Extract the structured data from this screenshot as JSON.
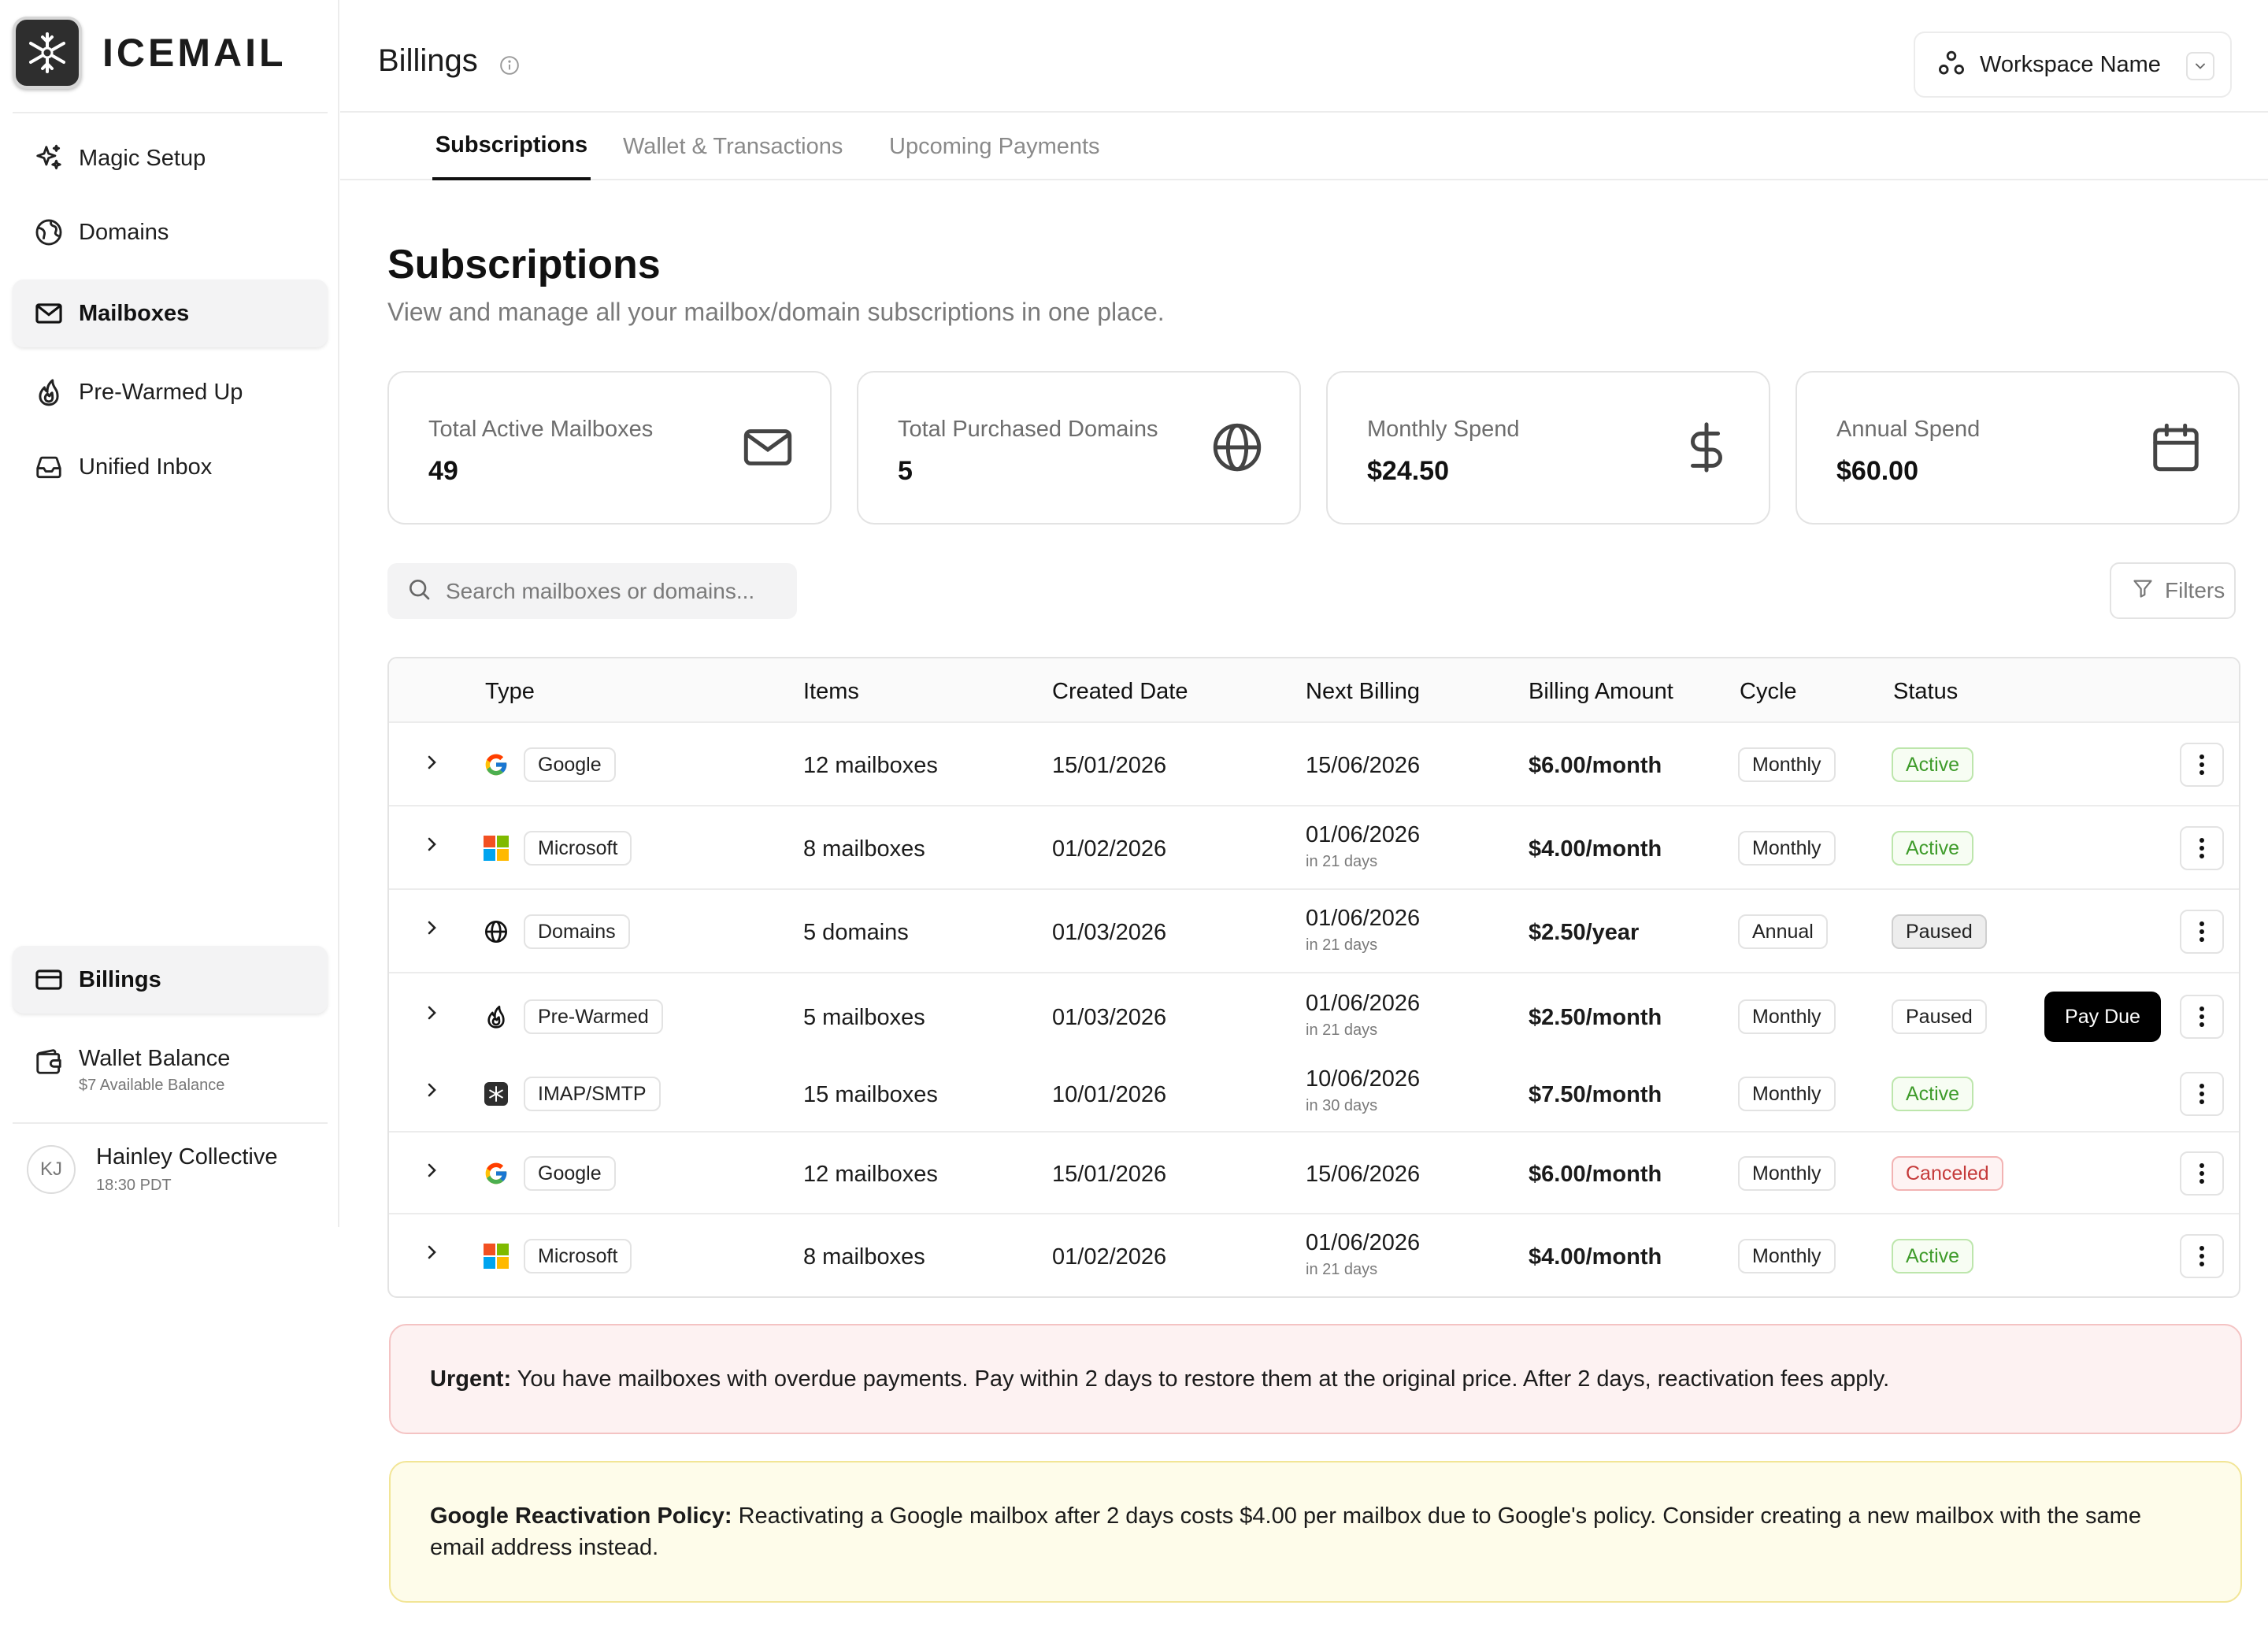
{
  "app": {
    "name": "ICEMAIL"
  },
  "sidebar": {
    "items": [
      {
        "label": "Magic Setup",
        "icon": "sparkles-icon"
      },
      {
        "label": "Domains",
        "icon": "globe-icon"
      },
      {
        "label": "Mailboxes",
        "icon": "mail-icon",
        "active": true
      },
      {
        "label": "Pre-Warmed Up",
        "icon": "flame-icon"
      },
      {
        "label": "Unified Inbox",
        "icon": "inbox-icon"
      }
    ],
    "billings": {
      "label": "Billings",
      "icon": "credit-card-icon",
      "active": true
    },
    "wallet": {
      "label": "Wallet Balance",
      "sub": "$7 Available Balance",
      "icon": "wallet-icon"
    },
    "user": {
      "initials": "KJ",
      "name": "Hainley Collective",
      "time": "18:30 PDT"
    }
  },
  "header": {
    "title": "Billings",
    "workspace": "Workspace Name"
  },
  "tabs": [
    {
      "label": "Subscriptions",
      "active": true
    },
    {
      "label": "Wallet & Transactions",
      "active": false
    },
    {
      "label": "Upcoming Payments",
      "active": false
    }
  ],
  "main": {
    "title": "Subscriptions",
    "subtitle": "View and manage all your mailbox/domain subscriptions in one place.",
    "cards": [
      {
        "label": "Total Active Mailboxes",
        "value": "49",
        "icon": "mail-icon"
      },
      {
        "label": "Total Purchased Domains",
        "value": "5",
        "icon": "globe-icon"
      },
      {
        "label": "Monthly Spend",
        "value": "$24.50",
        "icon": "dollar-icon"
      },
      {
        "label": "Annual Spend",
        "value": "$60.00",
        "icon": "calendar-icon"
      }
    ],
    "search_placeholder": "Search mailboxes or domains...",
    "filters_label": "Filters"
  },
  "table": {
    "columns": [
      "Type",
      "Items",
      "Created Date",
      "Next Billing",
      "Billing Amount",
      "Cycle",
      "Status"
    ],
    "pay_due_label": "Pay Due",
    "rows": [
      {
        "type": "Google",
        "icon": "google-icon",
        "items": "12 mailboxes",
        "created": "15/01/2026",
        "next": "15/06/2026",
        "next_sub": "",
        "amount": "$6.00/month",
        "cycle": "Monthly",
        "status": "Active",
        "status_kind": "active"
      },
      {
        "type": "Microsoft",
        "icon": "microsoft-icon",
        "items": "8 mailboxes",
        "created": "01/02/2026",
        "next": "01/06/2026",
        "next_sub": "in 21 days",
        "amount": "$4.00/month",
        "cycle": "Monthly",
        "status": "Active",
        "status_kind": "active"
      },
      {
        "type": "Domains",
        "icon": "globe-icon",
        "items": "5 domains",
        "created": "01/03/2026",
        "next": "01/06/2026",
        "next_sub": "in 21 days",
        "amount": "$2.50/year",
        "cycle": "Annual",
        "status": "Paused",
        "status_kind": "paused"
      },
      {
        "type": "Pre-Warmed",
        "icon": "flame-icon",
        "items": "5 mailboxes",
        "created": "01/03/2026",
        "next": "01/06/2026",
        "next_sub": "in 21 days",
        "amount": "$2.50/month",
        "cycle": "Monthly",
        "status": "Paused",
        "status_kind": "paused2",
        "pay_due": true
      },
      {
        "type": "IMAP/SMTP",
        "icon": "imap-icon",
        "items": "15 mailboxes",
        "created": "10/01/2026",
        "next": "10/06/2026",
        "next_sub": "in 30 days",
        "amount": "$7.50/month",
        "cycle": "Monthly",
        "status": "Active",
        "status_kind": "active"
      },
      {
        "type": "Google",
        "icon": "google-icon",
        "items": "12 mailboxes",
        "created": "15/01/2026",
        "next": "15/06/2026",
        "next_sub": "",
        "amount": "$6.00/month",
        "cycle": "Monthly",
        "status": "Canceled",
        "status_kind": "canceled"
      },
      {
        "type": "Microsoft",
        "icon": "microsoft-icon",
        "items": "8 mailboxes",
        "created": "01/02/2026",
        "next": "01/06/2026",
        "next_sub": "in 21 days",
        "amount": "$4.00/month",
        "cycle": "Monthly",
        "status": "Active",
        "status_kind": "active"
      }
    ]
  },
  "alerts": {
    "urgent": {
      "title": "Urgent:",
      "text": "You have mailboxes with overdue payments. Pay within 2 days to restore them at the original price. After 2 days, reactivation fees apply."
    },
    "policy": {
      "title": "Google Reactivation Policy:",
      "text": "Reactivating a Google mailbox after 2 days costs $4.00 per mailbox due to Google's policy. Consider creating a new mailbox with the same email address instead."
    }
  }
}
